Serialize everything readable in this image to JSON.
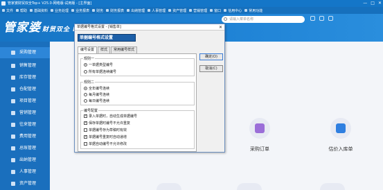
{
  "window": {
    "title": "管家婆财贸双全Top+ V25.0-网络版-试用版 - [主界面]",
    "controls": [
      "—",
      "□",
      "✕"
    ]
  },
  "menubar": {
    "items": [
      "文件",
      "帮助",
      "基础资料",
      "业务处理",
      "业务报表",
      "财务",
      "财务报表",
      "出纳管理",
      "人事管理",
      "资产管理",
      "营销管理",
      "窗口",
      "信用中心",
      "常用功能"
    ]
  },
  "header": {
    "logo": "管家婆",
    "logo_sub": "财贸双全 II T",
    "search_placeholder": "请输入菜单名称"
  },
  "sidebar": {
    "items": [
      {
        "label": "采购管理",
        "icon": "cart-icon",
        "active": true
      },
      {
        "label": "销售管理",
        "icon": "chart-icon",
        "active": false
      },
      {
        "label": "库存管理",
        "icon": "box-icon",
        "active": false
      },
      {
        "label": "仓配管理",
        "icon": "warehouse-icon",
        "active": false
      },
      {
        "label": "项目管理",
        "icon": "project-icon",
        "active": false
      },
      {
        "label": "营销管理",
        "icon": "tag-icon",
        "active": false
      },
      {
        "label": "往来管理",
        "icon": "exchange-icon",
        "active": false
      },
      {
        "label": "费用管理",
        "icon": "fee-icon",
        "active": false
      },
      {
        "label": "总账管理",
        "icon": "ledger-icon",
        "active": false
      },
      {
        "label": "出纳管理",
        "icon": "cash-icon",
        "active": false
      },
      {
        "label": "人事管理",
        "icon": "person-icon",
        "active": false
      },
      {
        "label": "资产管理",
        "icon": "asset-icon",
        "active": false
      }
    ]
  },
  "main": {
    "tiles": [
      {
        "label": "采购订单",
        "icon": "purchase-order-icon",
        "color": "#9b6ed8"
      },
      {
        "label": "估价入库单",
        "icon": "valuation-inbound-icon",
        "color": "#2f7fe0"
      }
    ]
  },
  "dialog": {
    "title": "单据编号格式设置 - [销售单]",
    "close": "✕",
    "banner": "单据编号格式设置",
    "tabs": [
      "编号设置",
      "样式",
      "常用编号样式"
    ],
    "active_tab": 0,
    "groups": [
      {
        "title": "规则一",
        "options": [
          {
            "label": "一单据类型编号",
            "checked": true
          },
          {
            "label": "所有单据连续编号",
            "checked": false
          }
        ]
      },
      {
        "title": "规则二",
        "options": [
          {
            "label": "全年编号连续",
            "checked": true
          },
          {
            "label": "每月编号连续",
            "checked": false
          },
          {
            "label": "每日编号连续",
            "checked": false
          }
        ]
      },
      {
        "title": "编号配置",
        "options": [
          {
            "label": "录入单据时，自动生成单据编号",
            "checked": true
          },
          {
            "label": "保存单据时编号不允许重复",
            "checked": true
          },
          {
            "label": "单据编号存为草稿时有效",
            "checked": false
          },
          {
            "label": "单据编号重复时自动递增",
            "checked": true
          },
          {
            "label": "单据自动编号不允许修改",
            "checked": false
          }
        ]
      }
    ],
    "ok_label": "确定(O)",
    "cancel_label": "取消(C)"
  },
  "colors": {
    "brand_blue": "#1a6fbd",
    "dialog_banner": "#1c5fa8"
  }
}
